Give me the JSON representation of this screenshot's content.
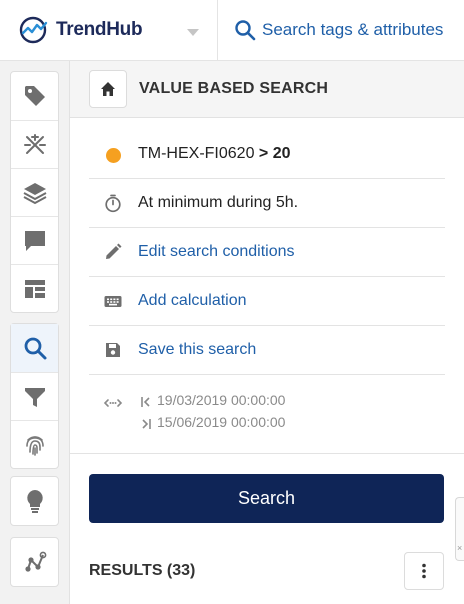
{
  "header": {
    "logo_text": "TrendHub",
    "search_placeholder": "Search tags & attributes"
  },
  "sidebar": {
    "groups": [
      [
        "tag-icon",
        "asset-icon",
        "layers-icon",
        "comment-icon",
        "dashboard-icon"
      ],
      [
        "search-icon",
        "filter-icon",
        "fingerprint-icon"
      ],
      [
        "lightbulb-icon"
      ],
      [
        "graph-icon"
      ]
    ],
    "active": "search-icon"
  },
  "panel": {
    "title": "VALUE BASED SEARCH",
    "condition": {
      "tag": "TM-HEX-FI0620",
      "operator": ">",
      "value": "20",
      "status_color": "#f5a020"
    },
    "duration": "At minimum during 5h.",
    "actions": {
      "edit": "Edit search conditions",
      "calc": "Add calculation",
      "save": "Save this search"
    },
    "dates": {
      "start": "19/03/2019 00:00:00",
      "end": "15/06/2019 00:00:00"
    },
    "search_button": "Search",
    "results_label": "RESULTS (33)"
  },
  "colors": {
    "accent": "#0f2557",
    "link": "#1f5fa8",
    "status": "#f5a020"
  }
}
